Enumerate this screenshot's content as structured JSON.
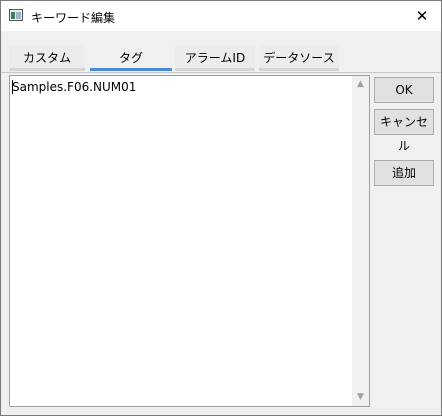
{
  "window": {
    "title": "キーワード編集",
    "close_glyph": "✕",
    "app_icon": "application-icon"
  },
  "tabs": [
    {
      "label": "カスタム",
      "active": false
    },
    {
      "label": "タグ",
      "active": true
    },
    {
      "label": "アラームID",
      "active": false
    },
    {
      "label": "データソース",
      "active": false
    }
  ],
  "editor": {
    "value": "Samples.F06.NUM01",
    "scroll_up_glyph": "▲",
    "scroll_down_glyph": "▼"
  },
  "buttons": {
    "ok": "OK",
    "cancel": "キャンセル",
    "add": "追加"
  },
  "colors": {
    "active_tab_underline": "#4a8ad6",
    "window_background": "#f0f0f0"
  }
}
